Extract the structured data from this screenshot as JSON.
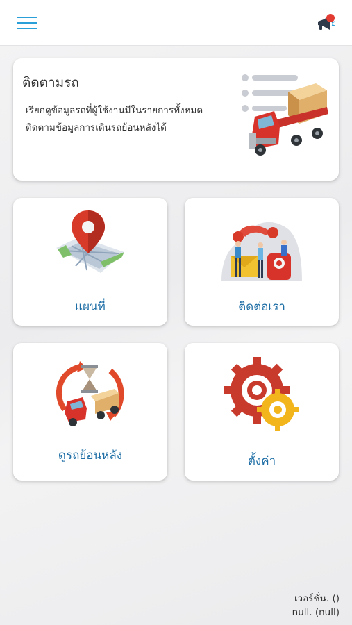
{
  "header": {
    "menu_icon": "hamburger-menu-icon",
    "notification_icon": "megaphone-icon",
    "accent_color": "#2b9fd8"
  },
  "track_card": {
    "title": "ติดตามรถ",
    "description_line1": "เรียกดูข้อมูลรถที่ผู้ใช้งานมีในรายการทั้งหมด",
    "description_line2": "ติดตามข้อมูลการเดินรถย้อนหลังได้",
    "illustration": "truck-list-illustration"
  },
  "tiles": [
    {
      "label": "แผนที่",
      "icon": "map-pin-illustration"
    },
    {
      "label": "ติดต่อเรา",
      "icon": "contact-us-illustration"
    },
    {
      "label": "ดูรถย้อนหลัง",
      "icon": "truck-history-illustration"
    },
    {
      "label": "ตั้งค่า",
      "icon": "gears-illustration"
    }
  ],
  "footer": {
    "version_label": "เวอร์ชั่น. ()",
    "version_value": "null. (null)"
  },
  "colors": {
    "tile_label": "#1f6fa6",
    "truck_red": "#d8332b",
    "gear_red": "#c83a2c",
    "gear_yellow": "#f2b51c"
  }
}
